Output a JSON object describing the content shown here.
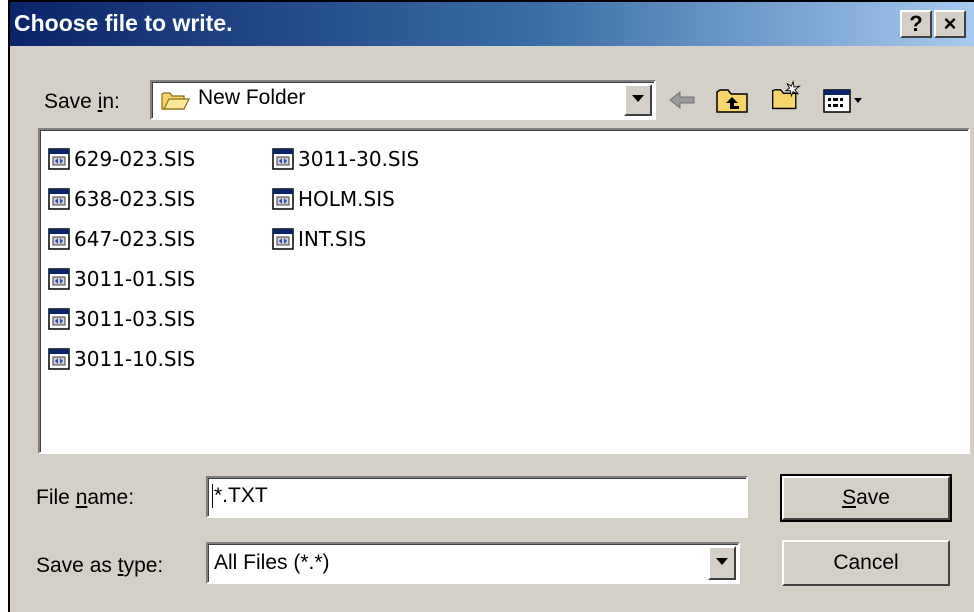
{
  "window": {
    "title": "Choose file to write.",
    "help_label": "?",
    "close_label": "×"
  },
  "save_in": {
    "label_pre": "Save ",
    "label_hot": "i",
    "label_post": "n:",
    "value": "New Folder"
  },
  "toolbar": {
    "icons": [
      "back-arrow-icon",
      "up-one-level-icon",
      "create-new-folder-icon",
      "view-menu-icon"
    ]
  },
  "files": {
    "column1": [
      {
        "name": "629-023.SIS",
        "icon": "sis-file-icon"
      },
      {
        "name": "638-023.SIS",
        "icon": "sis-file-icon"
      },
      {
        "name": "647-023.SIS",
        "icon": "sis-file-icon"
      },
      {
        "name": "3011-01.SIS",
        "icon": "sis-file-icon"
      },
      {
        "name": "3011-03.SIS",
        "icon": "sis-file-icon"
      },
      {
        "name": "3011-10.SIS",
        "icon": "sis-file-icon"
      }
    ],
    "column2": [
      {
        "name": "3011-30.SIS",
        "icon": "sis-file-icon"
      },
      {
        "name": "HOLM.SIS",
        "icon": "sis-file-icon"
      },
      {
        "name": "INT.SIS",
        "icon": "sis-file-icon"
      }
    ]
  },
  "file_name": {
    "label_pre": "File ",
    "label_hot": "n",
    "label_post": "ame:",
    "value": "*.TXT"
  },
  "save_as_type": {
    "label_pre": "Save as ",
    "label_hot": "t",
    "label_post": "ype:",
    "value": "All Files (*.*)"
  },
  "buttons": {
    "save_hot": "S",
    "save_rest": "ave",
    "cancel": "Cancel"
  },
  "colors": {
    "title_bar_start": "#0a246a",
    "title_bar_end": "#a6caf0",
    "dialog_face": "#d4d0c8"
  }
}
